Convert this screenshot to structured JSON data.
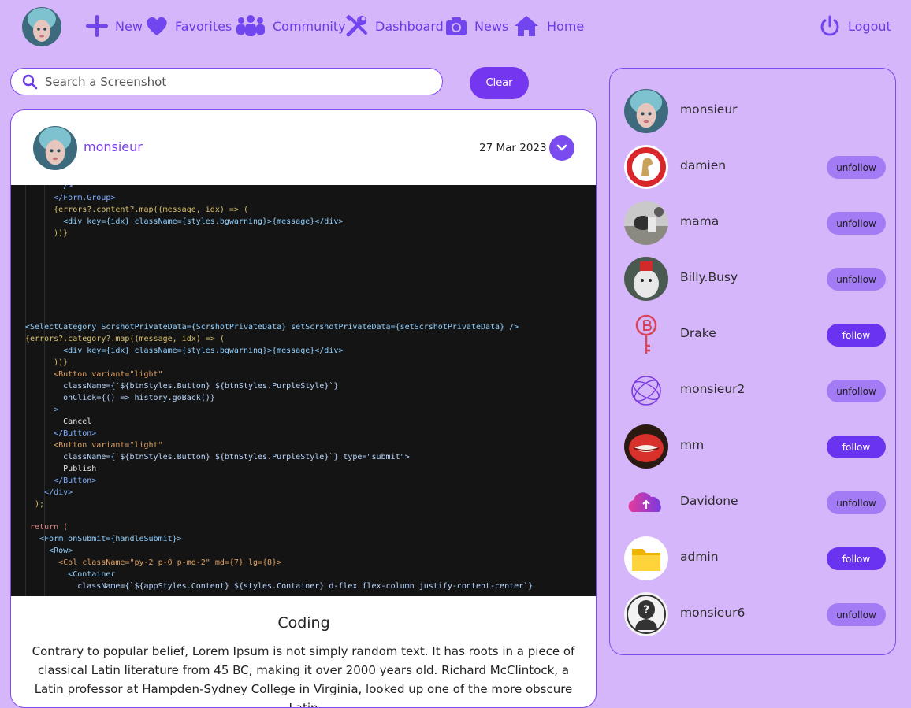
{
  "nav": {
    "items": [
      {
        "label": "New",
        "icon": "plus-icon"
      },
      {
        "label": "Favorites",
        "icon": "heart-icon"
      },
      {
        "label": "Community",
        "icon": "people-icon"
      },
      {
        "label": "Dashboard",
        "icon": "tools-icon"
      },
      {
        "label": "News",
        "icon": "camera-icon"
      },
      {
        "label": "Home",
        "icon": "home-icon"
      }
    ],
    "logout_label": "Logout"
  },
  "search": {
    "placeholder": "Search a Screenshot",
    "value": "",
    "clear_label": "Clear"
  },
  "post": {
    "author": "monsieur",
    "date": "27 Mar 2023",
    "title": "Coding",
    "body": "Contrary to popular belief, Lorem Ipsum is not simply random text. It has roots in a piece of classical Latin literature from 45 BC, making it over 2000 years old. Richard McClintock, a Latin professor at Hampden-Sydney College in Virginia, looked up one of the more obscure Latin",
    "code_lines": [
      "        />",
      "      </Form.Group>",
      "      {errors?.content?.map((message, idx) => (",
      "        <div key={idx} className={styles.bgwarning}>{message}</div>",
      "      ))}",
      "<SelectCategory ScrshotPrivateData={ScrshotPrivateData} setScrshotPrivateData={setScrshotPrivateData} />",
      "{errors?.category?.map((message, idx) => (",
      "        <div key={idx} className={styles.bgwarning}>{message}</div>",
      "      ))}",
      "      <Button variant=\"light\"",
      "        className={`${btnStyles.Button} ${btnStyles.PurpleStyle}`}",
      "        onClick={() => history.goBack()}",
      "      >",
      "        Cancel",
      "      </Button>",
      "      <Button variant=\"light\"",
      "        className={`${btnStyles.Button} ${btnStyles.PurpleStyle}`} type=\"submit\">",
      "        Publish",
      "      </Button>",
      "    </div>",
      "  );",
      " return (",
      "   <Form onSubmit={handleSubmit}>",
      "     <Row>",
      "       <Col className=\"py-2 p-0 p-md-2\" md={7} lg={8}>",
      "         <Container",
      "           className={`${appStyles.Content} ${styles.Container} d-flex flex-column justify-content-center`}"
    ]
  },
  "users": [
    {
      "name": "monsieur",
      "button": null
    },
    {
      "name": "damien",
      "button": "unfollow"
    },
    {
      "name": "mama",
      "button": "unfollow"
    },
    {
      "name": "Billy.Busy",
      "button": "unfollow"
    },
    {
      "name": "Drake",
      "button": "follow"
    },
    {
      "name": "monsieur2",
      "button": "unfollow"
    },
    {
      "name": "mm",
      "button": "follow"
    },
    {
      "name": "Davidone",
      "button": "unfollow"
    },
    {
      "name": "admin",
      "button": "follow"
    },
    {
      "name": "monsieur6",
      "button": "unfollow"
    }
  ],
  "colors": {
    "background": "#d6b6fb",
    "accent": "#7436ee",
    "follow_button": "#6a33f0",
    "unfollow_button": "#a27bf5"
  }
}
